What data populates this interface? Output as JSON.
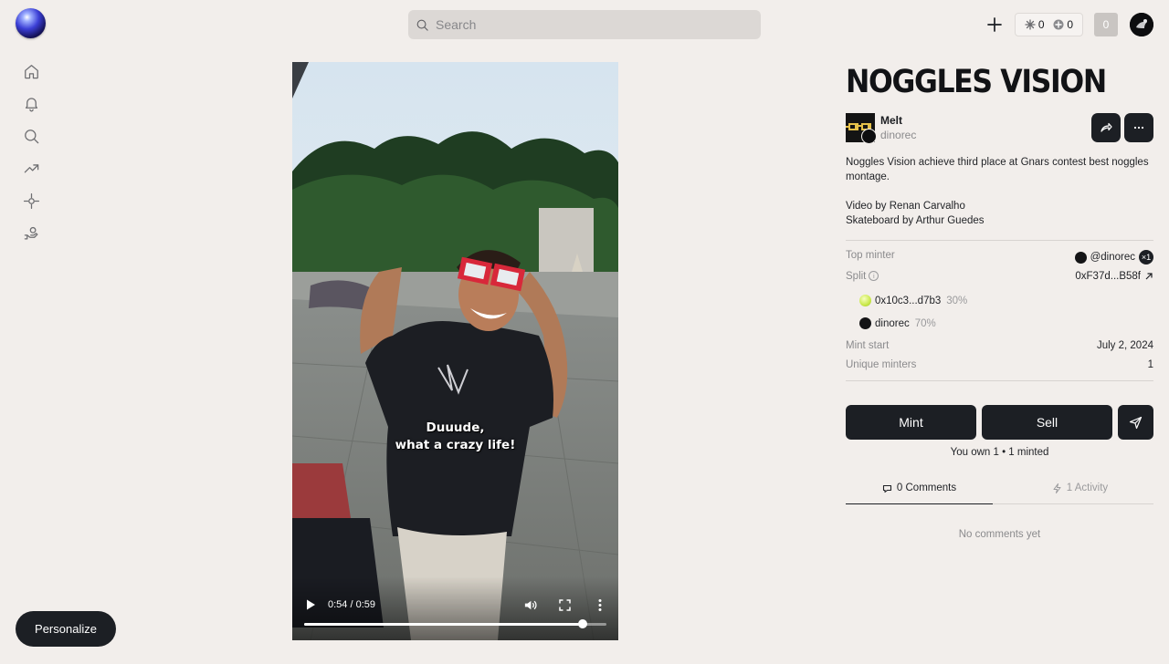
{
  "header": {
    "search_placeholder": "Search",
    "counter_a": "0",
    "counter_b": "0",
    "notif_count": "0"
  },
  "sidebar": {
    "items": [
      "home",
      "notifications",
      "search",
      "trending",
      "explore",
      "rewards"
    ]
  },
  "personalize_label": "Personalize",
  "video": {
    "caption_line1": "Duuude,",
    "caption_line2": "what a crazy life!",
    "time": "0:54 / 0:59",
    "progress": 0.92
  },
  "post": {
    "title": "NOGGLES VISION",
    "creator_name": "Melt",
    "creator_handle": "dinorec",
    "description_1": "Noggles Vision achieve third place at Gnars contest best noggles montage.",
    "description_2": "Video by Renan Carvalho",
    "description_3": "Skateboard by Arthur Guedes"
  },
  "details": {
    "top_minter_label": "Top minter",
    "top_minter_value": "@dinorec",
    "top_minter_count": "×1",
    "split_label": "Split",
    "split_address": "0xF37d...B58f",
    "split_recipients": [
      {
        "name": "0x10c3...d7b3",
        "pct": "30%"
      },
      {
        "name": "dinorec",
        "pct": "70%"
      }
    ],
    "mint_start_label": "Mint start",
    "mint_start_value": "July 2, 2024",
    "unique_minters_label": "Unique minters",
    "unique_minters_value": "1"
  },
  "actions": {
    "mint_label": "Mint",
    "sell_label": "Sell",
    "own_text": "You own 1 • 1 minted"
  },
  "tabs": {
    "comments_label": "0 Comments",
    "activity_label": "1 Activity",
    "empty_text": "No comments yet"
  }
}
